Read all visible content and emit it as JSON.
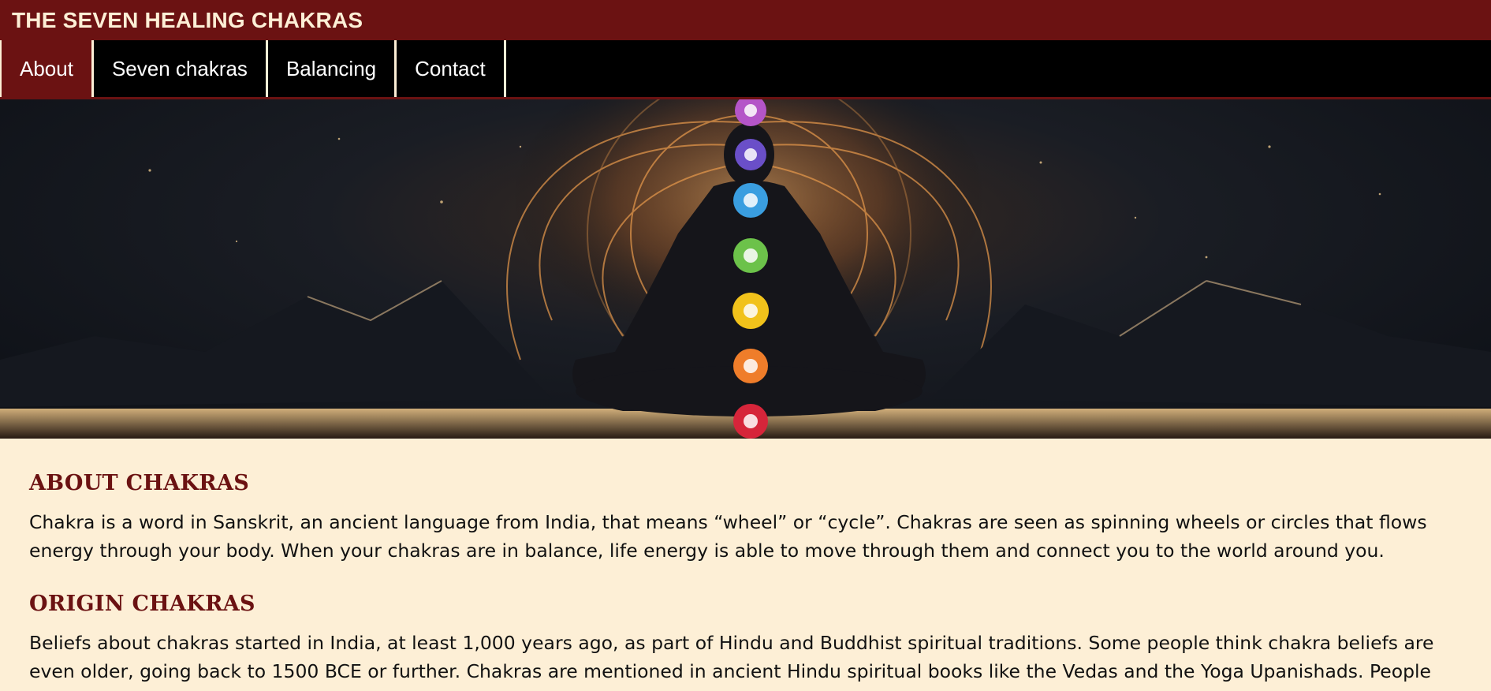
{
  "header": {
    "title": "THE SEVEN HEALING CHAKRAS"
  },
  "nav": {
    "items": [
      {
        "label": "About",
        "active": true
      },
      {
        "label": "Seven chakras",
        "active": false
      },
      {
        "label": "Balancing",
        "active": false
      },
      {
        "label": "Contact",
        "active": false
      }
    ]
  },
  "hero": {
    "image": "meditating-figure-with-chakras"
  },
  "sections": [
    {
      "title": "ABOUT CHAKRAS",
      "text": "Chakra is a word in Sanskrit, an ancient language from India, that means “wheel” or “cycle”. Chakras are seen as spinning wheels or circles that flows energy through your body. When your chakras are in balance, life energy is able to move through them and connect you to the world around you."
    },
    {
      "title": "ORIGIN CHAKRAS",
      "text": "Beliefs about chakras started in India, at least 1,000 years ago, as part of Hindu and Buddhist spiritual traditions. Some people think chakra beliefs are even older, going back to 1500 BCE or further. Chakras are mentioned in ancient Hindu spiritual books like the Vedas and the Yoga Upanishads. People probably believed in"
    }
  ],
  "colors": {
    "brand": "#6b1212",
    "background": "#fdefd6",
    "nav_bg": "#000000"
  }
}
